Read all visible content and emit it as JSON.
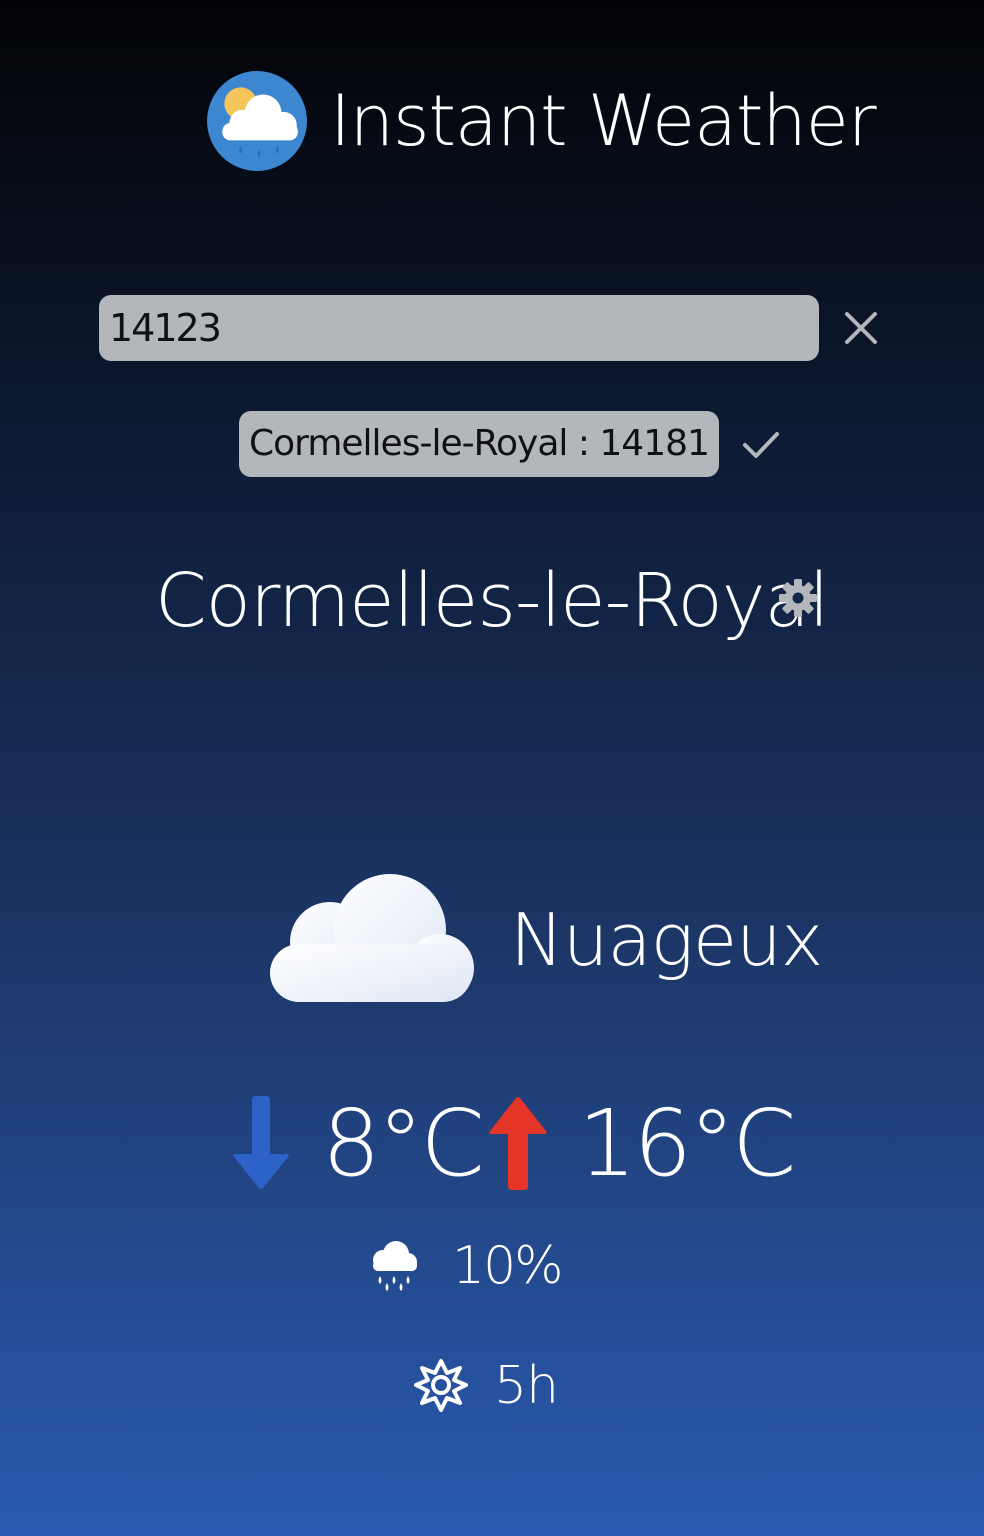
{
  "app": {
    "title": "Instant Weather",
    "logo_icon": "sun-cloud-rain-icon"
  },
  "search": {
    "value": "14123",
    "clear_icon": "close-icon"
  },
  "suggestion": {
    "label": "Cormelles-le-Royal : 14181",
    "confirm_icon": "check-icon"
  },
  "location": {
    "city": "Cormelles-le-Royal",
    "settings_icon": "gear-icon"
  },
  "weather": {
    "condition": "Nuageux",
    "condition_icon": "cloud-icon",
    "temp_min": "8°C",
    "temp_max": "16°C",
    "rain_probability": "10%",
    "sunshine_hours": "5h"
  },
  "colors": {
    "min_arrow": "#2d63c8",
    "max_arrow": "#e43526",
    "input_bg": "#b3b7bc"
  }
}
